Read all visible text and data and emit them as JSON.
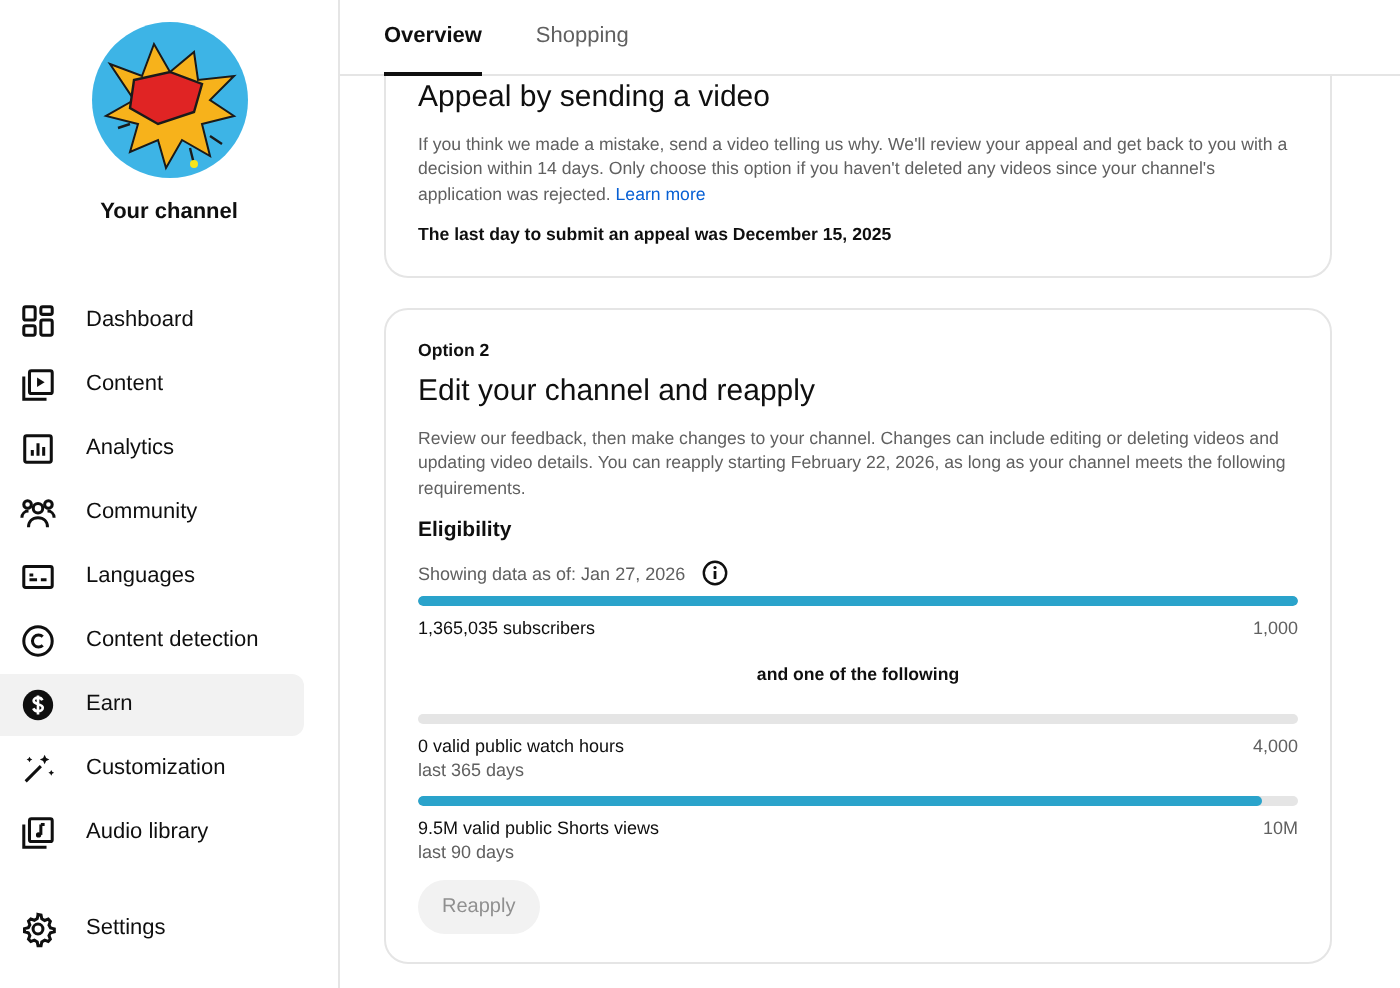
{
  "channel": {
    "label": "Your channel"
  },
  "sidebar": {
    "items": [
      {
        "label": "Dashboard",
        "selected": false
      },
      {
        "label": "Content",
        "selected": false
      },
      {
        "label": "Analytics",
        "selected": false
      },
      {
        "label": "Community",
        "selected": false
      },
      {
        "label": "Languages",
        "selected": false
      },
      {
        "label": "Content detection",
        "selected": false
      },
      {
        "label": "Earn",
        "selected": true
      },
      {
        "label": "Customization",
        "selected": false
      },
      {
        "label": "Audio library",
        "selected": false
      }
    ],
    "footer_items": [
      {
        "label": "Settings",
        "selected": false
      }
    ]
  },
  "tabs": [
    {
      "label": "Overview",
      "selected": true
    },
    {
      "label": "Shopping",
      "selected": false
    }
  ],
  "appeal_card": {
    "title": "Appeal by sending a video",
    "body": "If you think we made a mistake, send a video telling us why. We'll review your appeal and get back to you with a decision within 14 days. Only choose this option if you haven't deleted any videos since your channel's application was rejected.",
    "link": "Learn more",
    "deadline": "The last day to submit an appeal was December 15, 2025"
  },
  "reapply_card": {
    "option": "Option 2",
    "title": "Edit your channel and reapply",
    "body": "Review our feedback, then make changes to your channel. Changes can include editing or deleting videos and updating video details. You can reapply starting February 22, 2026, as long as your channel meets the following requirements.",
    "eligibility": "Eligibility",
    "data_as_of": "Showing data as of: Jan 27, 2026",
    "requirements": [
      {
        "kind": "meter",
        "level": 1,
        "label": "1,365,035 subscribers",
        "target": "1,000"
      },
      {
        "kind": "separator",
        "label": "and one of the following"
      },
      {
        "kind": "meter",
        "level": 0,
        "label": "0 valid public watch hours",
        "period": "last 365 days",
        "target": "4,000"
      },
      {
        "kind": "meter",
        "level": 0.96,
        "label": "9.5M valid public Shorts views",
        "period": "last 90 days",
        "target": "10M"
      }
    ],
    "button": {
      "label": "Reapply",
      "disabled": true
    }
  }
}
